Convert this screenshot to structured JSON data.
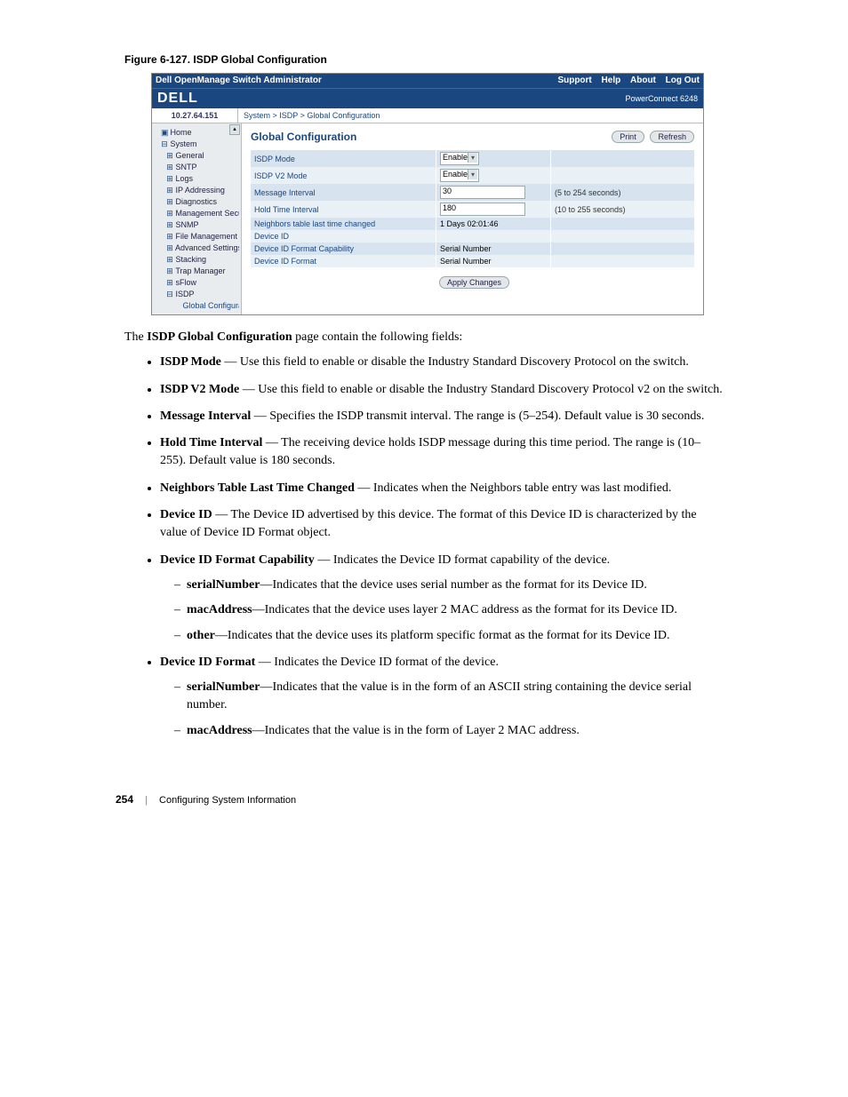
{
  "figure_caption": "Figure 6-127.    ISDP Global Configuration",
  "screenshot": {
    "top_title": "Dell OpenManage Switch Administrator",
    "top_links": [
      "Support",
      "Help",
      "About",
      "Log Out"
    ],
    "logo": "DELL",
    "model": "PowerConnect 6248",
    "ip": "10.27.64.151",
    "breadcrumb": "System > ISDP > Global Configuration",
    "tree": [
      {
        "l": 0,
        "icon": "▣",
        "t": "Home"
      },
      {
        "l": 0,
        "icon": "⊟",
        "t": "System"
      },
      {
        "l": 1,
        "icon": "⊞",
        "t": "General"
      },
      {
        "l": 1,
        "icon": "⊞",
        "t": "SNTP"
      },
      {
        "l": 1,
        "icon": "⊞",
        "t": "Logs"
      },
      {
        "l": 1,
        "icon": "⊞",
        "t": "IP Addressing"
      },
      {
        "l": 1,
        "icon": "⊞",
        "t": "Diagnostics"
      },
      {
        "l": 1,
        "icon": "⊞",
        "t": "Management Secur"
      },
      {
        "l": 1,
        "icon": "⊞",
        "t": "SNMP"
      },
      {
        "l": 1,
        "icon": "⊞",
        "t": "File Management"
      },
      {
        "l": 1,
        "icon": "⊞",
        "t": "Advanced Settings"
      },
      {
        "l": 1,
        "icon": "⊞",
        "t": "Stacking"
      },
      {
        "l": 1,
        "icon": "⊞",
        "t": "Trap Manager"
      },
      {
        "l": 1,
        "icon": "⊞",
        "t": "sFlow"
      },
      {
        "l": 1,
        "icon": "⊟",
        "t": "ISDP"
      },
      {
        "l": 2,
        "icon": "",
        "t": "Global Configurat"
      }
    ],
    "page_title": "Global Configuration",
    "btn_print": "Print",
    "btn_refresh": "Refresh",
    "rows": [
      {
        "label": "ISDP Mode",
        "type": "select",
        "value": "Enable",
        "hint": ""
      },
      {
        "label": "ISDP V2 Mode",
        "type": "select",
        "value": "Enable",
        "hint": ""
      },
      {
        "label": "Message Interval",
        "type": "input",
        "value": "30",
        "hint": "(5 to 254 seconds)"
      },
      {
        "label": "Hold Time Interval",
        "type": "input",
        "value": "180",
        "hint": "(10 to 255 seconds)"
      },
      {
        "label": "Neighbors table last time changed",
        "type": "text",
        "value": "1 Days 02:01:46",
        "hint": ""
      },
      {
        "label": "Device ID",
        "type": "text",
        "value": "",
        "hint": ""
      },
      {
        "label": "Device ID Format Capability",
        "type": "text",
        "value": "Serial Number",
        "hint": ""
      },
      {
        "label": "Device ID Format",
        "type": "text",
        "value": "Serial Number",
        "hint": ""
      }
    ],
    "btn_apply": "Apply Changes"
  },
  "intro": {
    "pre": "The ",
    "b": "ISDP Global Configuration",
    "post": " page contain the following fields:"
  },
  "bullets": [
    {
      "b": "ISDP Mode",
      "post": " — Use this field to enable or disable the Industry Standard Discovery Protocol on the switch."
    },
    {
      "b": "ISDP V2 Mode",
      "post": " — Use this field to enable or disable the Industry Standard Discovery Protocol v2 on the switch."
    },
    {
      "b": "Message Interval",
      "post": " — Specifies the ISDP transmit interval. The range is (5–254). Default value is 30 seconds."
    },
    {
      "b": "Hold Time Interval",
      "post": " — The receiving device holds ISDP message during this time period. The range is (10–255). Default value is 180 seconds."
    },
    {
      "b": "Neighbors Table Last Time Changed",
      "post": " — Indicates when the Neighbors table entry was last modified."
    },
    {
      "b": "Device ID",
      "post": " — The Device ID advertised by this device. The format of this Device ID is characterized by the value of Device ID Format object."
    },
    {
      "b": "Device ID Format Capability",
      "post": " — Indicates the Device ID format capability of the device.",
      "sub": [
        {
          "b": "serialNumber",
          "post": "—Indicates that the device uses serial number as the format for its Device ID."
        },
        {
          "b": "macAddress",
          "post": "—Indicates that the device uses layer 2 MAC address as the format for its Device ID."
        },
        {
          "b": "other",
          "post": "—Indicates that the device uses its platform specific format as the format for its Device ID."
        }
      ]
    },
    {
      "b": "Device ID Format",
      "post": " — Indicates the Device ID format of the device.",
      "sub": [
        {
          "b": "serialNumber",
          "post": "—Indicates that the value is in the form of an ASCII string containing the device serial number."
        },
        {
          "b": "macAddress",
          "post": "—Indicates that the value is in the form of Layer 2 MAC address."
        }
      ]
    }
  ],
  "footer": {
    "page": "254",
    "section": "Configuring System Information"
  }
}
